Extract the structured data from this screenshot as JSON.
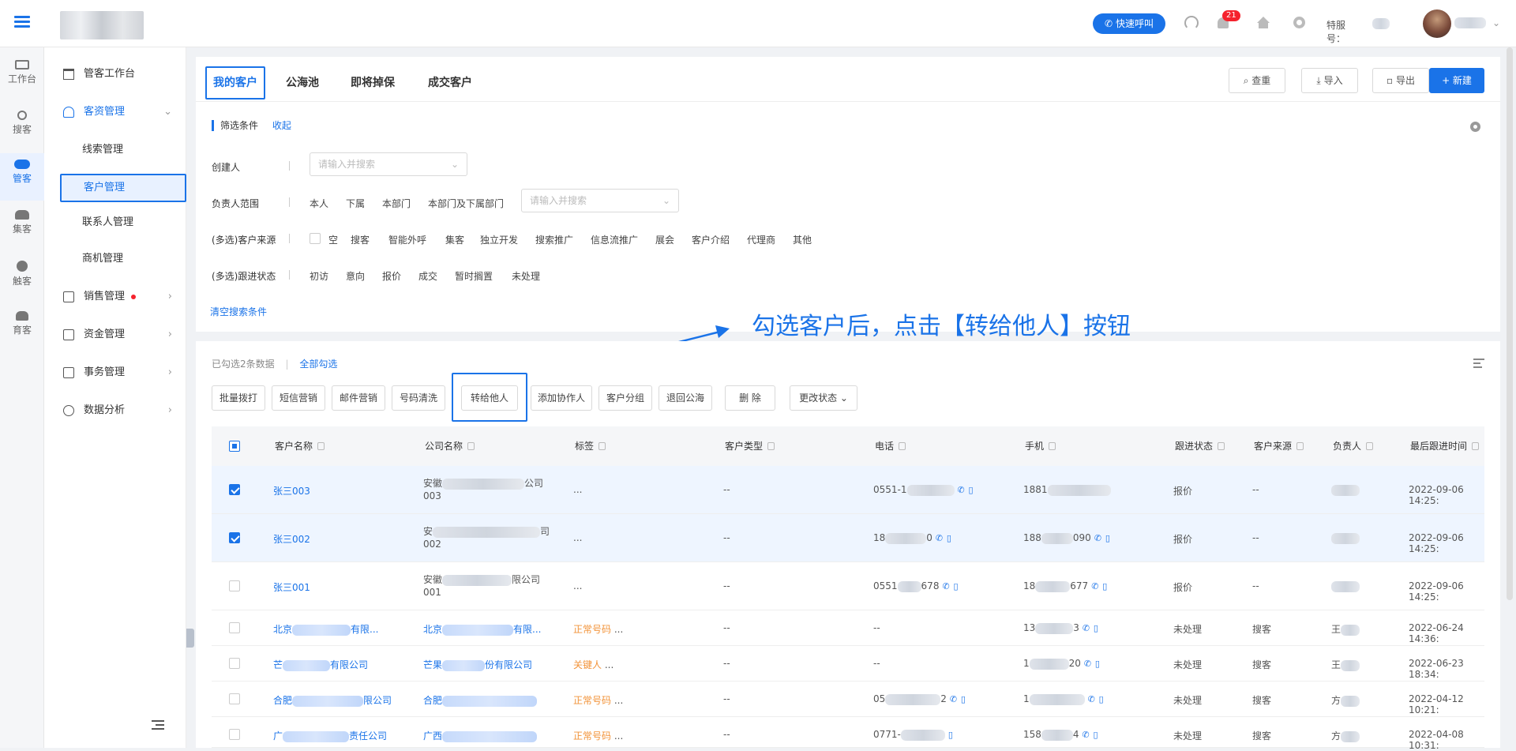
{
  "rail": [
    {
      "label": "工作台",
      "icon": "monitor-icon"
    },
    {
      "label": "搜客",
      "icon": "search-user-icon"
    },
    {
      "label": "管客",
      "icon": "crm-icon",
      "active": true
    },
    {
      "label": "集客",
      "icon": "group-icon"
    },
    {
      "label": "触客",
      "icon": "headset-icon"
    },
    {
      "label": "育客",
      "icon": "nurture-icon"
    }
  ],
  "header": {
    "quick_call": "快速呼叫",
    "badge_count": "21",
    "service_label": "特服号："
  },
  "sidebar": {
    "workbench": "管客工作台",
    "customer_mgmt": "客资管理",
    "sub": [
      "线索管理",
      "客户管理",
      "联系人管理",
      "商机管理"
    ],
    "sales": "销售管理",
    "finance": "资金管理",
    "affairs": "事务管理",
    "analytics": "数据分析"
  },
  "tabs": [
    "我的客户",
    "公海池",
    "即将掉保",
    "成交客户"
  ],
  "top_buttons": {
    "dedupe": "查重",
    "import": "导入",
    "export": "导出",
    "create": "+ 新建"
  },
  "filter": {
    "title": "筛选条件",
    "collapse": "收起",
    "creator_label": "创建人",
    "creator_placeholder": "请输入并搜索",
    "owner_label": "负责人范围",
    "owner_opts": [
      "本人",
      "下属",
      "本部门",
      "本部门及下属部门"
    ],
    "owner_placeholder": "请输入并搜索",
    "source_label": "(多选)客户来源",
    "source_opts": [
      "空",
      "搜客",
      "智能外呼",
      "集客",
      "独立开发",
      "搜索推广",
      "信息流推广",
      "展会",
      "客户介绍",
      "代理商",
      "其他"
    ],
    "status_label": "(多选)跟进状态",
    "status_opts": [
      "初访",
      "意向",
      "报价",
      "成交",
      "暂时搁置",
      "未处理"
    ],
    "clear": "清空搜索条件"
  },
  "selection": {
    "selected_text": "已勾选2条数据",
    "select_all": "全部勾选"
  },
  "actions": [
    "批量拨打",
    "短信营销",
    "邮件营销",
    "号码清洗",
    "转给他人",
    "添加协作人",
    "客户分组",
    "退回公海",
    "删 除",
    "更改状态 ⌄"
  ],
  "columns": [
    "客户名称",
    "公司名称",
    "标签",
    "客户类型",
    "电话",
    "手机",
    "跟进状态",
    "客户来源",
    "负责人",
    "最后跟进时间"
  ],
  "rows": [
    {
      "name": "张三003",
      "company": "安徽",
      "company_suffix": "公司",
      "company_line2": "003",
      "tag": "...",
      "ctype": "--",
      "tel": "0551-1",
      "mobile": "1881",
      "status": "报价",
      "source": "--",
      "owner": "",
      "time": "2022-09-06 14:25:",
      "checked": true
    },
    {
      "name": "张三002",
      "company": "安",
      "company_suffix": "司",
      "company_line2": "002",
      "tag": "...",
      "ctype": "--",
      "tel": "18",
      "tel_tail": "0",
      "mobile": "188",
      "mobile_tail": "090",
      "status": "报价",
      "source": "--",
      "owner": "",
      "time": "2022-09-06 14:25:",
      "checked": true
    },
    {
      "name": "张三001",
      "company": "安徽",
      "company_suffix": "限公司",
      "company_line2": "001",
      "tag": "...",
      "ctype": "--",
      "tel": "0551",
      "tel_tail": "678",
      "mobile": "18",
      "mobile_tail": "677",
      "status": "报价",
      "source": "--",
      "owner": "",
      "time": "2022-09-06 14:25:",
      "checked": false
    },
    {
      "name": "北京",
      "name_suffix": "有限...",
      "company": "北京",
      "company_suffix": "有限...",
      "tag": "正常号码",
      "tag_more": "...",
      "ctype": "--",
      "tel": "--",
      "mobile": "13",
      "mobile_tail": "3",
      "status": "未处理",
      "source": "搜客",
      "owner": "王",
      "time": "2022-06-24 14:36:",
      "checked": false
    },
    {
      "name": "芒",
      "name_suffix": "有限公司",
      "company": "芒果",
      "company_suffix": "份有限公司",
      "tag": "关键人",
      "tag_more": "...",
      "ctype": "--",
      "tel": "--",
      "mobile": "1",
      "mobile_tail": "20",
      "status": "未处理",
      "source": "搜客",
      "owner": "王",
      "time": "2022-06-23 18:34:",
      "checked": false
    },
    {
      "name": "合肥",
      "name_suffix": "限公司",
      "company": "合肥",
      "company_suffix": "",
      "tag": "正常号码",
      "tag_more": "...",
      "ctype": "--",
      "tel": "05",
      "tel_tail": "2",
      "mobile": "1",
      "mobile_tail": "",
      "status": "未处理",
      "source": "搜客",
      "owner": "方",
      "time": "2022-04-12 10:21:",
      "checked": false
    },
    {
      "name": "广",
      "name_suffix": "责任公司",
      "company": "广西",
      "company_suffix": "",
      "tag": "正常号码",
      "tag_more": "...",
      "ctype": "--",
      "tel": "0771-",
      "tel_tail": "",
      "mobile": "158",
      "mobile_tail": "4",
      "status": "未处理",
      "source": "搜客",
      "owner": "方",
      "time": "2022-04-08 10:31:",
      "checked": false
    }
  ],
  "annotation": "勾选客户后，点击【转给他人】按钮",
  "colors": {
    "accent": "#1a73e8",
    "tag_orange": "#f29339"
  }
}
